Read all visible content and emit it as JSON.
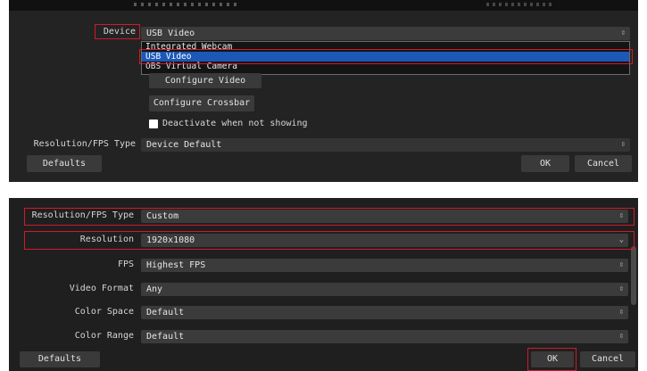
{
  "panel1": {
    "device_label": "Device",
    "device_value": "USB Video",
    "dropdown_items": [
      "Integrated Webcam",
      "USB Video",
      "OBS Virtual Camera"
    ],
    "configure_video_label": "Configure Video",
    "configure_crossbar_label": "Configure Crossbar",
    "deactivate_label": "Deactivate when not showing",
    "deactivate_checked": true,
    "res_fps_type_label": "Resolution/FPS Type",
    "res_fps_type_value": "Device Default",
    "defaults_label": "Defaults",
    "ok_label": "OK",
    "cancel_label": "Cancel"
  },
  "panel2": {
    "res_fps_type_label": "Resolution/FPS Type",
    "res_fps_type_value": "Custom",
    "resolution_label": "Resolution",
    "resolution_value": "1920x1080",
    "fps_label": "FPS",
    "fps_value": "Highest FPS",
    "video_format_label": "Video Format",
    "video_format_value": "Any",
    "color_space_label": "Color Space",
    "color_space_value": "Default",
    "color_range_label": "Color Range",
    "color_range_value": "Default",
    "defaults_label": "Defaults",
    "ok_label": "OK",
    "cancel_label": "Cancel"
  },
  "icons": {
    "updown": "⇳",
    "down": "⌄"
  },
  "colors": {
    "highlight": "#d11a2a",
    "selection": "#1c58b8"
  }
}
